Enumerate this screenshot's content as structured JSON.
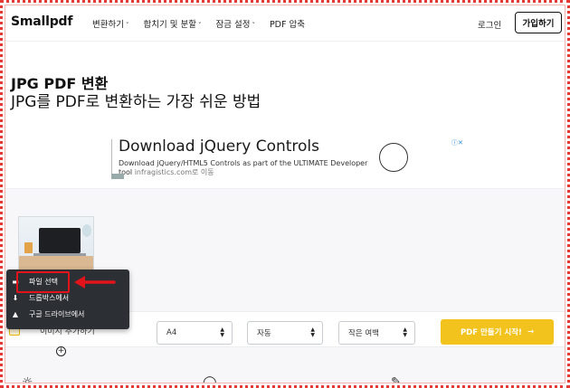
{
  "header": {
    "logo": "Smallpdf",
    "nav": [
      {
        "label": "변환하기",
        "chevron": "˅"
      },
      {
        "label": "합치기 및 분할",
        "chevron": "˅"
      },
      {
        "label": "잠금 설정",
        "chevron": "˅"
      },
      {
        "label": "PDF 압축",
        "chevron": ""
      }
    ],
    "login": "로그인",
    "signup": "가입하기"
  },
  "hero": {
    "title": "JPG PDF 변환",
    "subtitle": "JPG를 PDF로 변환하는 가장 쉬운 방법"
  },
  "ad": {
    "headline": "Download jQuery Controls",
    "desc_main": "Download jQuery/HTML5 Controls as part of the ULTIMATE Developer tool",
    "desc_link": "infragistics.com로 이동"
  },
  "tool": {
    "add_label": "이미지 추가하기",
    "plus": "+",
    "page_size": "A4",
    "orientation": "자동",
    "margin": "작은 여백",
    "cta_label": "PDF 만들기 시작!",
    "cta_arrow": "→"
  },
  "dropdown": {
    "items": [
      {
        "label": "파일 선택",
        "icon": "file-icon"
      },
      {
        "label": "드롭박스에서",
        "icon": "download-icon"
      },
      {
        "label": "구글 드라이브에서",
        "icon": "drive-icon"
      }
    ]
  },
  "colors": {
    "accent": "#f2c31d",
    "highlight": "#e3131b",
    "dropdown_bg": "#2c3034"
  }
}
